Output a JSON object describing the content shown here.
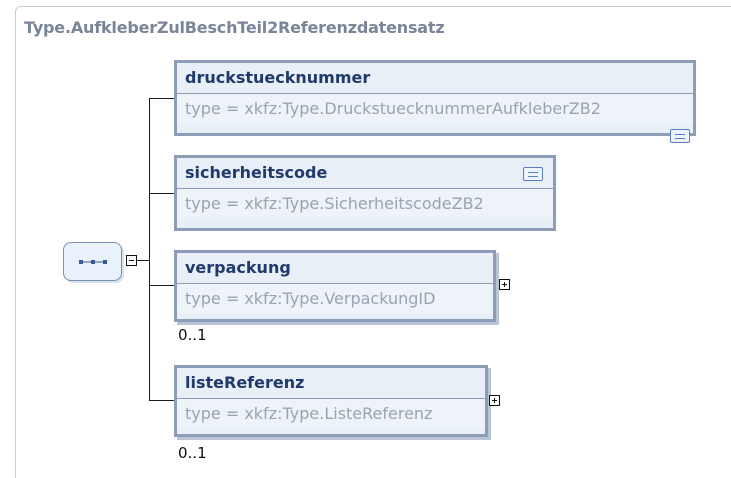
{
  "diagram": {
    "title": "Type.AufkleberZulBeschTeil2Referenzdatensatz",
    "elements": [
      {
        "name": "druckstuecknummer",
        "type": "type = xkfz:Type.DruckstuecknummerAufkleberZB2",
        "has_doc": true,
        "expandable": false,
        "cardinality": ""
      },
      {
        "name": "sicherheitscode",
        "type": "type = xkfz:Type.SicherheitscodeZB2",
        "has_doc": true,
        "expandable": false,
        "cardinality": ""
      },
      {
        "name": "verpackung",
        "type": "type = xkfz:Type.VerpackungID",
        "has_doc": false,
        "expandable": true,
        "cardinality": "0..1"
      },
      {
        "name": "listeReferenz",
        "type": "type = xkfz:Type.ListeReferenz",
        "has_doc": false,
        "expandable": true,
        "cardinality": "0..1"
      }
    ]
  }
}
